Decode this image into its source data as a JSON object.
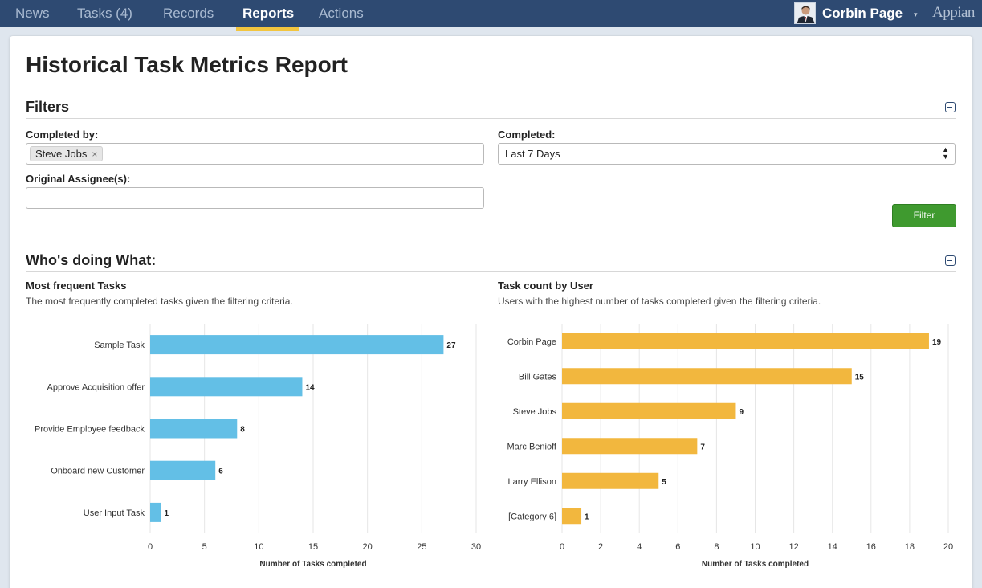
{
  "nav": {
    "tabs": [
      {
        "label": "News"
      },
      {
        "label": "Tasks (4)"
      },
      {
        "label": "Records"
      },
      {
        "label": "Reports"
      },
      {
        "label": "Actions"
      }
    ],
    "user_name": "Corbin Page",
    "user_caret": "▾",
    "brand": "Appian"
  },
  "page": {
    "title": "Historical Task Metrics Report"
  },
  "filters": {
    "title": "Filters",
    "completed_by_label": "Completed by:",
    "completed_by_token": "Steve Jobs",
    "token_remove": "×",
    "completed_label": "Completed:",
    "completed_value": "Last 7 Days",
    "assignee_label": "Original Assignee(s):",
    "assignee_value": "",
    "filter_button": "Filter"
  },
  "who": {
    "title": "Who's doing What:"
  },
  "charts": {
    "tasks": {
      "title": "Most frequent Tasks",
      "description": "The most frequently completed tasks given the filtering criteria."
    },
    "users": {
      "title": "Task count by User",
      "description": "Users with the highest number of tasks completed given the filtering criteria."
    }
  },
  "chart_data": [
    {
      "type": "bar",
      "orientation": "horizontal",
      "categories": [
        "Sample Task",
        "Approve Acquisition offer",
        "Provide Employee feedback",
        "Onboard new Customer",
        "User Input Task"
      ],
      "values": [
        27,
        14,
        8,
        6,
        1
      ],
      "xlabel": "Number of Tasks completed",
      "xlim": [
        0,
        30
      ],
      "ticks": [
        0,
        5,
        10,
        15,
        20,
        25,
        30
      ],
      "color": "#63bfe6",
      "grid": true
    },
    {
      "type": "bar",
      "orientation": "horizontal",
      "categories": [
        "Corbin Page",
        "Bill Gates",
        "Steve Jobs",
        "Marc Benioff",
        "Larry Ellison",
        "[Category 6]"
      ],
      "values": [
        19,
        15,
        9,
        7,
        5,
        1
      ],
      "xlabel": "Number of Tasks completed",
      "xlim": [
        0,
        20
      ],
      "ticks": [
        0,
        2,
        4,
        6,
        8,
        10,
        12,
        14,
        16,
        18,
        20
      ],
      "color": "#f2b73e",
      "grid": true
    }
  ]
}
